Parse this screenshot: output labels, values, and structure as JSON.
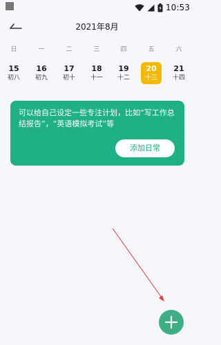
{
  "status_bar": {
    "time": "10:53",
    "icons": [
      "wifi-icon",
      "signal-icon",
      "battery-icon"
    ]
  },
  "header": {
    "title": "2021年8月",
    "back_icon": "back-icon"
  },
  "weekdays": [
    "日",
    "一",
    "二",
    "三",
    "四",
    "五",
    "六"
  ],
  "dates": [
    {
      "day": "15",
      "lunar": "初八"
    },
    {
      "day": "16",
      "lunar": "初九"
    },
    {
      "day": "17",
      "lunar": "初十"
    },
    {
      "day": "18",
      "lunar": "十一"
    },
    {
      "day": "19",
      "lunar": "十二"
    },
    {
      "day": "20",
      "lunar": "十三"
    },
    {
      "day": "21",
      "lunar": "十四"
    }
  ],
  "selected_date": "20",
  "tip_card": {
    "text": "可以给自己设定一些专注计划，比如“写工作总结报告”，“英语模拟考试”等",
    "button_label": "添加日常"
  },
  "fab": {
    "icon": "plus-icon"
  },
  "colors": {
    "accent_green": "#1fb185",
    "selected_yellow": "#f5b800",
    "fab_green": "#3fae84",
    "annotation_red": "#e23b3b"
  }
}
